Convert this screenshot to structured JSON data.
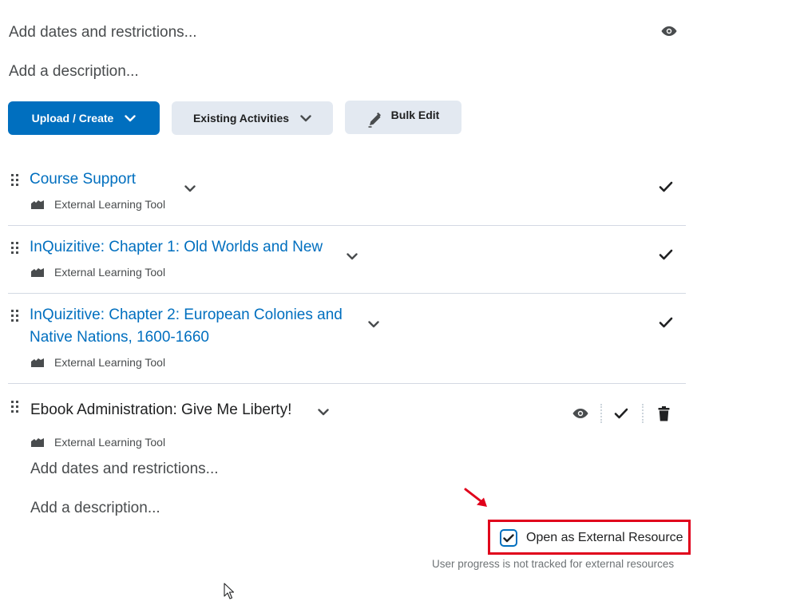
{
  "module": {
    "dates_link": "Add dates and restrictions...",
    "description_link": "Add a description..."
  },
  "toolbar": {
    "upload_create_label": "Upload / Create",
    "existing_activities_label": "Existing Activities",
    "bulk_edit_label": "Bulk Edit"
  },
  "items": [
    {
      "title": "Course Support",
      "type": "External Learning Tool"
    },
    {
      "title": "InQuizitive: Chapter 1: Old Worlds and New",
      "type": "External Learning Tool"
    },
    {
      "title_line1": "InQuizitive: Chapter 2: European Colonies and",
      "title_line2": "Native Nations, 1600-1660",
      "type": "External Learning Tool"
    },
    {
      "title": "Ebook Administration: Give Me Liberty!",
      "type": "External Learning Tool"
    }
  ],
  "expanded": {
    "dates_link": "Add dates and restrictions...",
    "description_link": "Add a description...",
    "external_resource_label": "Open as External Resource",
    "external_resource_checked": true,
    "external_resource_note": "User progress is not tracked for external resources"
  },
  "icons": {
    "visibility": "eye-icon",
    "complete": "checkmark-icon",
    "dropdown": "chevron-down-icon",
    "drag": "drag-handle-icon",
    "tool": "external-tool-icon",
    "delete": "trash-icon",
    "bulk_edit": "pencil-icon",
    "annotation": "red-arrow-icon",
    "cursor": "mouse-cursor-icon"
  },
  "colors": {
    "link_blue": "#006fbf",
    "primary_button": "#006fbf",
    "secondary_button": "#e3e9f1",
    "highlight_red": "#e0001b"
  }
}
